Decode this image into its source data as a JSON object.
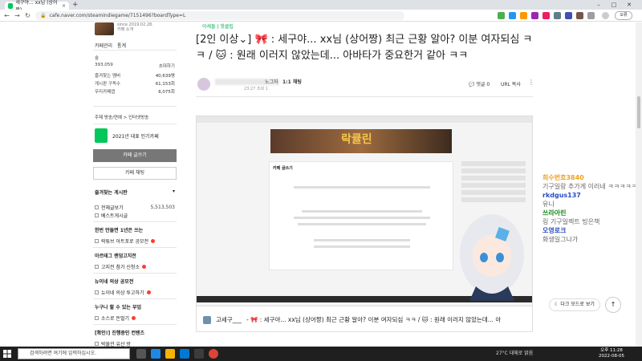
{
  "browser": {
    "tab_title": "세구야... xx님 (상어짱)",
    "tab_close": "×",
    "new_tab": "+",
    "url": "cafe.naver.com/steamindiegame/7151496?boardType=L",
    "profile_label": "오류",
    "win_min": "–",
    "win_max": "□",
    "win_close": "✕"
  },
  "sidebar": {
    "since": "since 2019.02.28.",
    "cafe_intro": "카페 소개",
    "manage": "카페관리",
    "stats": "통계",
    "member_label": "숲",
    "member_count": "393,059",
    "invite": "초대하기",
    "rows": [
      {
        "label": "즐겨찾는 멤버",
        "value": "40,639명"
      },
      {
        "label": "게시판 구독수",
        "value": "61,153회"
      },
      {
        "label": "우리카페앱",
        "value": "6,075회"
      }
    ],
    "category": "주제  방송/연예 > 인터넷방송",
    "badge_text": "2021년 대표 인기카페",
    "write_btn": "카페 글쓰기",
    "chat_btn": "카페 채팅",
    "fav_title": "즐겨찾는 게시판",
    "fav_arrow": "▾",
    "items": [
      {
        "label": "전체글보기",
        "count": "5,513,503"
      },
      {
        "label": "베스트게시글",
        "count": ""
      }
    ],
    "sections": [
      {
        "title": "한번 만들면 1년은 쓰는",
        "item": "락튜브 아트포로 공모전"
      },
      {
        "title": "아르테그 랜덤고지전",
        "item": "고지전 참가 신청소"
      },
      {
        "title": "뉴이네 의상 공모전",
        "item": "뉴이네 의상 투고하기"
      },
      {
        "title": "누구나 할 수 있는 부업",
        "item": "소스로 돈벌기"
      },
      {
        "title": "[확인!] 진행중인 컨텐츠",
        "item": "박물관 유산 방"
      }
    ]
  },
  "article": {
    "breadcrumb": "이세돌 | 핫클립",
    "title": "[2인 이상⌄] 🎀 : 세구야... xx님 (상어짱) 최근 근황 알아? 이분 여자되심 ㅋㅋ / 🐱 : 원래 이러지 않았는데... 아바타가 중요한거 같아 ㅋㅋ",
    "author_suffix": "노그자",
    "chat_tag": "1:1 채팅",
    "meta": "23:27  조회 1",
    "comments": "댓글 0",
    "url_copy": "URL 복사",
    "more": "⋮",
    "video_banner": "락큘린",
    "video_form_title": "카페 글쓰기",
    "caption_author": "고세구___",
    "caption_text": "- 🎀 : 세구야... xx님 (상어짱) 최근 근황 알아? 이분 여자되심 ㅋㅋ / 🐱 : 원래 이러지 않았는데... 아"
  },
  "chat": [
    {
      "name": "희수번호3840",
      "msg": "기구일랑 추가게 이러네 ㅋㅋㅋㅋㅋ",
      "color": "#f0a020"
    },
    {
      "name": "rkdgus137",
      "msg": "유니",
      "color": "#2b4bc4"
    },
    {
      "name": "쓰라아린",
      "msg": "링 기구일렉트 빙은책",
      "color": "#1a8a1a"
    },
    {
      "name": "오영로크",
      "msg": "화생일그나가",
      "color": "#2b4bc4"
    }
  ],
  "floating": {
    "dark_mode": "다크 모드로 보기",
    "top": "↑"
  },
  "taskbar": {
    "search_placeholder": "검색하려면 여기에 입력하십시오.",
    "weather": "27°C 대체로 맑음",
    "time": "오후 11:28",
    "date": "2022-08-05"
  }
}
